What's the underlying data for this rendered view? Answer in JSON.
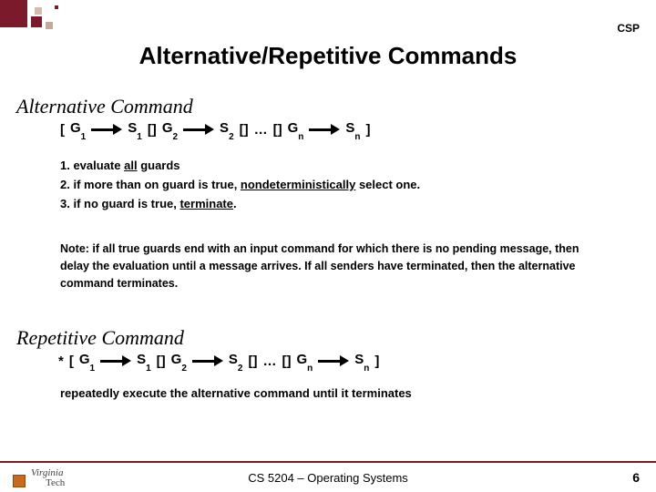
{
  "header": {
    "label": "CSP"
  },
  "title": "Alternative/Repetitive Commands",
  "alt": {
    "heading": "Alternative Command",
    "lbr": "[ ",
    "g": "G",
    "s": "S",
    "sep": "[]",
    "dots": "…",
    "rbr": "]",
    "sub1": "1",
    "sub2": "2",
    "subn": "n",
    "rule1_pre": "1. evaluate ",
    "rule1_ul": "all",
    "rule1_post": " guards",
    "rule2_pre": "2. if more than on guard is true, ",
    "rule2_ul": "nondeterministically",
    "rule2_post": " select one.",
    "rule3_pre": "3. if no guard is true, ",
    "rule3_ul": "terminate",
    "rule3_post": ".",
    "note": "Note: if all true guards end with an input command for which there is no pending message, then delay the evaluation until a message arrives. If all senders have terminated, then the alternative command terminates."
  },
  "rep": {
    "heading": "Repetitive Command",
    "star": "*",
    "desc": "repeatedly execute the alternative command until it terminates"
  },
  "footer": {
    "course": "CS 5204 – Operating Systems",
    "page": "6",
    "logo_top": "Virginia",
    "logo_bot": "Tech"
  },
  "decor": {
    "maroon": "#7a1a2b",
    "tan": "#d8baaa",
    "dust": "#c7a99a"
  }
}
